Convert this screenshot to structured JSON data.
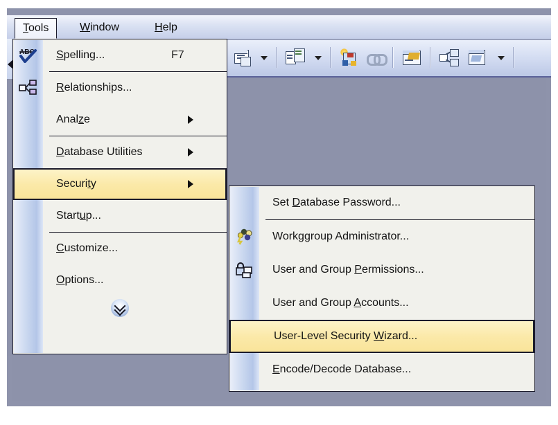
{
  "app": {
    "title": "Microsoft Access - Tools menu",
    "background_color": "#8e93ab",
    "menu_background_color": "#f1f1ec",
    "highlight_color": "#fbe9a8",
    "border_color": "#1b1b2c"
  },
  "menubar": {
    "items": [
      {
        "label": "Tools",
        "mnemonic": "T",
        "state": "open"
      },
      {
        "label": "Window",
        "mnemonic": "W",
        "state": "normal"
      },
      {
        "label": "Help",
        "mnemonic": "H",
        "state": "normal"
      }
    ]
  },
  "toolbar": {
    "name": "database-toolbar",
    "buttons": [
      {
        "name": "new-object-button",
        "icon": "table-window-icon",
        "has_dropdown": true
      },
      {
        "name": "relationships-button",
        "icon": "relationships-icon",
        "has_dropdown": true
      },
      {
        "name": "new-object-wizard-button",
        "icon": "new-object-icon",
        "has_dropdown": false
      },
      {
        "name": "insert-hyperlink-button",
        "icon": "hyperlink-icon",
        "has_dropdown": false
      },
      {
        "name": "code-window-button",
        "icon": "code-window-icon",
        "has_dropdown": false
      },
      {
        "name": "analyze-button",
        "icon": "analyze-icon",
        "has_dropdown": false
      },
      {
        "name": "database-window-button",
        "icon": "database-window-icon",
        "has_dropdown": true
      }
    ]
  },
  "tools_menu": {
    "name": "tools-menu",
    "items": [
      {
        "label": "Spelling...",
        "mnemonic": "S",
        "accelerator": "F7",
        "icon": "spelling-abc-check-icon",
        "submenu": false,
        "highlighted": false,
        "separator_after": true
      },
      {
        "label": "Relationships...",
        "mnemonic": "R",
        "accelerator": "",
        "icon": "relationships-icon",
        "submenu": false,
        "highlighted": false,
        "separator_after": false
      },
      {
        "label": "Analyze",
        "mnemonic": "z",
        "accelerator": "",
        "icon": "",
        "submenu": true,
        "highlighted": false,
        "separator_after": true
      },
      {
        "label": "Database Utilities",
        "mnemonic": "D",
        "accelerator": "",
        "icon": "",
        "submenu": true,
        "highlighted": false,
        "separator_after": false
      },
      {
        "label": "Security",
        "mnemonic": "t",
        "accelerator": "",
        "icon": "",
        "submenu": true,
        "highlighted": true,
        "separator_after": false
      },
      {
        "label": "Startup...",
        "mnemonic": "u",
        "accelerator": "",
        "icon": "",
        "submenu": false,
        "highlighted": false,
        "separator_after": true
      },
      {
        "label": "Customize...",
        "mnemonic": "C",
        "accelerator": "",
        "icon": "",
        "submenu": false,
        "highlighted": false,
        "separator_after": false
      },
      {
        "label": "Options...",
        "mnemonic": "O",
        "accelerator": "",
        "icon": "",
        "submenu": false,
        "highlighted": false,
        "separator_after": false
      }
    ],
    "expander": {
      "name": "expand-menu-button",
      "icon": "double-chevron-down-icon"
    }
  },
  "security_submenu": {
    "name": "security-submenu",
    "items": [
      {
        "label": "Set Database Password...",
        "mnemonic": "D",
        "icon": "",
        "highlighted": false,
        "separator_after": true
      },
      {
        "label": "Workgroup Administrator...",
        "mnemonic": "g",
        "icon": "workgroup-key-people-icon",
        "highlighted": false,
        "separator_after": false
      },
      {
        "label": "User and Group Permissions...",
        "mnemonic": "P",
        "icon": "lock-permissions-icon",
        "highlighted": false,
        "separator_after": false
      },
      {
        "label": "User and Group Accounts...",
        "mnemonic": "A",
        "icon": "",
        "highlighted": false,
        "separator_after": false
      },
      {
        "label": "User-Level Security Wizard...",
        "mnemonic": "W",
        "icon": "",
        "highlighted": true,
        "separator_after": false
      },
      {
        "label": "Encode/Decode Database...",
        "mnemonic": "E",
        "icon": "",
        "highlighted": false,
        "separator_after": false
      }
    ]
  }
}
